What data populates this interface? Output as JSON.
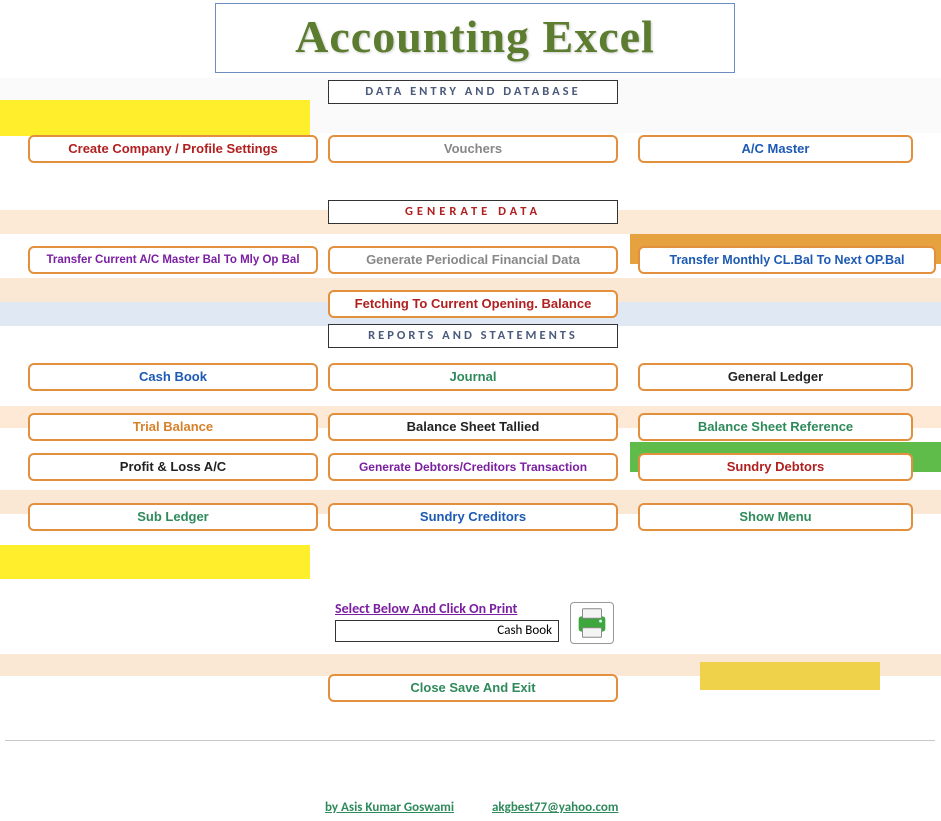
{
  "title": "Accounting Excel",
  "sections": {
    "data_entry": "DATA ENTRY AND DATABASE",
    "generate": "GENERATE   DATA",
    "reports": "REPORTS  AND  STATEMENTS"
  },
  "buttons": {
    "create_company": "Create Company / Profile Settings",
    "vouchers": "Vouchers",
    "ac_master": "A/C   Master",
    "transfer_master_bal": "Transfer Current A/C Master Bal  To Mly Op Bal",
    "gen_periodical": "Generate Periodical Financial Data",
    "transfer_monthly": "Transfer Monthly  CL.Bal To Next OP.Bal",
    "fetching_opening": "Fetching  To Current Opening. Balance",
    "cash_book": "Cash Book",
    "journal": "Journal",
    "general_ledger": "General Ledger",
    "trial_balance": "Trial Balance",
    "balance_sheet_tallied": "Balance Sheet Tallied",
    "balance_sheet_ref": "Balance Sheet Reference",
    "profit_loss": "Profit & Loss A/C",
    "gen_debtors_creditors": "Generate Debtors/Creditors Transaction",
    "sundry_debtors": "Sundry Debtors",
    "sub_ledger": "Sub Ledger",
    "sundry_creditors": "Sundry Creditors",
    "show_menu": "Show Menu",
    "close_save_exit": "Close Save And Exit"
  },
  "print": {
    "label": "Select Below And Click On Print",
    "value": "Cash Book"
  },
  "footer": {
    "author": "by Asis Kumar Goswami",
    "email": "akgbest77@yahoo.com"
  },
  "colors": {
    "orange_border": "#e2903e",
    "text_gray": "#888888",
    "text_blue": "#1c5ab3",
    "text_purple": "#7a1fa0",
    "text_green": "#2f8a5b",
    "text_red": "#b02020",
    "text_orange": "#d7812a",
    "text_black": "#222222"
  }
}
